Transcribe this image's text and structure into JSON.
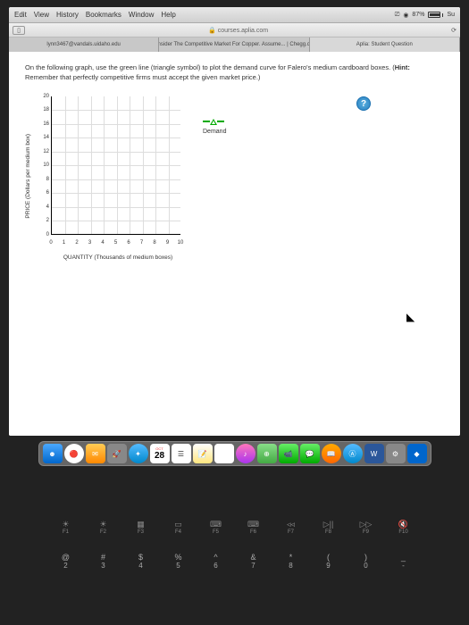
{
  "menubar": {
    "items": [
      "Edit",
      "View",
      "History",
      "Bookmarks",
      "Window",
      "Help"
    ],
    "battery_pct": "87%",
    "su": "Su"
  },
  "toolbar": {
    "address": "courses.aplia.com",
    "lock": "🔒"
  },
  "tabs": [
    {
      "label": "lynn3467@vandals.uidaho.edu"
    },
    {
      "label": "Consider The Competitive Market For Copper. Assume... | Chegg.com"
    },
    {
      "label": "Aplia: Student Question"
    }
  ],
  "content": {
    "instruction_pre": "On the following graph, use the green line (triangle symbol) to plot the demand curve for Falero's medium cardboard boxes. (",
    "hint_label": "Hint:",
    "instruction_post": " Remember that perfectly competitive firms must accept the given market price.)",
    "help": "?"
  },
  "chart_data": {
    "type": "line",
    "title": "",
    "xlabel": "QUANTITY (Thousands of medium boxes)",
    "ylabel": "PRICE (Dollars per medium box)",
    "xlim": [
      0,
      10
    ],
    "ylim": [
      0,
      20
    ],
    "xticks": [
      0,
      1,
      2,
      3,
      4,
      5,
      6,
      7,
      8,
      9,
      10
    ],
    "yticks": [
      0,
      2,
      4,
      6,
      8,
      10,
      12,
      14,
      16,
      18,
      20
    ],
    "series": [
      {
        "name": "Demand",
        "values": []
      }
    ],
    "legend": {
      "demand": "Demand"
    }
  },
  "dock": {
    "calendar_day": "28",
    "calendar_month": "OCT"
  },
  "keyboard": {
    "fn": [
      {
        "icon": "☀",
        "label": "F1"
      },
      {
        "icon": "☀",
        "label": "F2"
      },
      {
        "icon": "▦",
        "label": "F3"
      },
      {
        "icon": "▭",
        "label": "F4"
      },
      {
        "icon": "⌨",
        "label": "F5"
      },
      {
        "icon": "⌨",
        "label": "F6"
      },
      {
        "icon": "◃◃",
        "label": "F7"
      },
      {
        "icon": "▷||",
        "label": "F8"
      },
      {
        "icon": "▷▷",
        "label": "F9"
      },
      {
        "icon": "🔇",
        "label": "F10"
      }
    ],
    "nums": [
      {
        "sym": "@",
        "num": "2"
      },
      {
        "sym": "#",
        "num": "3"
      },
      {
        "sym": "$",
        "num": "4"
      },
      {
        "sym": "%",
        "num": "5"
      },
      {
        "sym": "^",
        "num": "6"
      },
      {
        "sym": "&",
        "num": "7"
      },
      {
        "sym": "*",
        "num": "8"
      },
      {
        "sym": "(",
        "num": "9"
      },
      {
        "sym": ")",
        "num": "0"
      },
      {
        "sym": "_",
        "num": "-"
      }
    ]
  }
}
